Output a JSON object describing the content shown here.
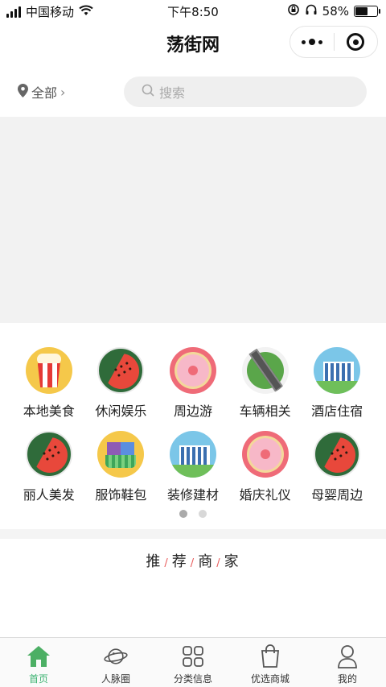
{
  "status_bar": {
    "carrier": "中国移动",
    "time": "下午8:50",
    "battery_percent": "58%",
    "battery_level": 0.58
  },
  "nav": {
    "title": "荡街网"
  },
  "location": {
    "label": "全部",
    "chevron": "›"
  },
  "search": {
    "placeholder": "搜索"
  },
  "categories": [
    {
      "label": "本地美食",
      "icon": "popcorn-icon"
    },
    {
      "label": "休闲娱乐",
      "icon": "watermelon-icon"
    },
    {
      "label": "周边游",
      "icon": "donut-icon"
    },
    {
      "label": "车辆相关",
      "icon": "car-road-icon"
    },
    {
      "label": "酒店住宿",
      "icon": "hotel-building-icon"
    },
    {
      "label": "丽人美发",
      "icon": "watermelon-icon"
    },
    {
      "label": "服饰鞋包",
      "icon": "shopping-basket-icon"
    },
    {
      "label": "装修建材",
      "icon": "hotel-building-icon"
    },
    {
      "label": "婚庆礼仪",
      "icon": "donut-icon"
    },
    {
      "label": "母婴周边",
      "icon": "watermelon-icon"
    }
  ],
  "pager": {
    "pages": 2,
    "current": 1
  },
  "recommend": {
    "chars": [
      "推",
      "荐",
      "商",
      "家"
    ],
    "separator": "/"
  },
  "tabs": [
    {
      "label": "首页",
      "icon": "home-icon",
      "active": true
    },
    {
      "label": "人脉圈",
      "icon": "planet-icon",
      "active": false
    },
    {
      "label": "分类信息",
      "icon": "grid-icon",
      "active": false
    },
    {
      "label": "优选商城",
      "icon": "shopping-bag-icon",
      "active": false
    },
    {
      "label": "我的",
      "icon": "user-icon",
      "active": false
    }
  ],
  "colors": {
    "accent_green": "#3cb371",
    "separator_red": "#e85a5a",
    "banner_bg": "#f2f2f2",
    "search_bg": "#efefef"
  }
}
